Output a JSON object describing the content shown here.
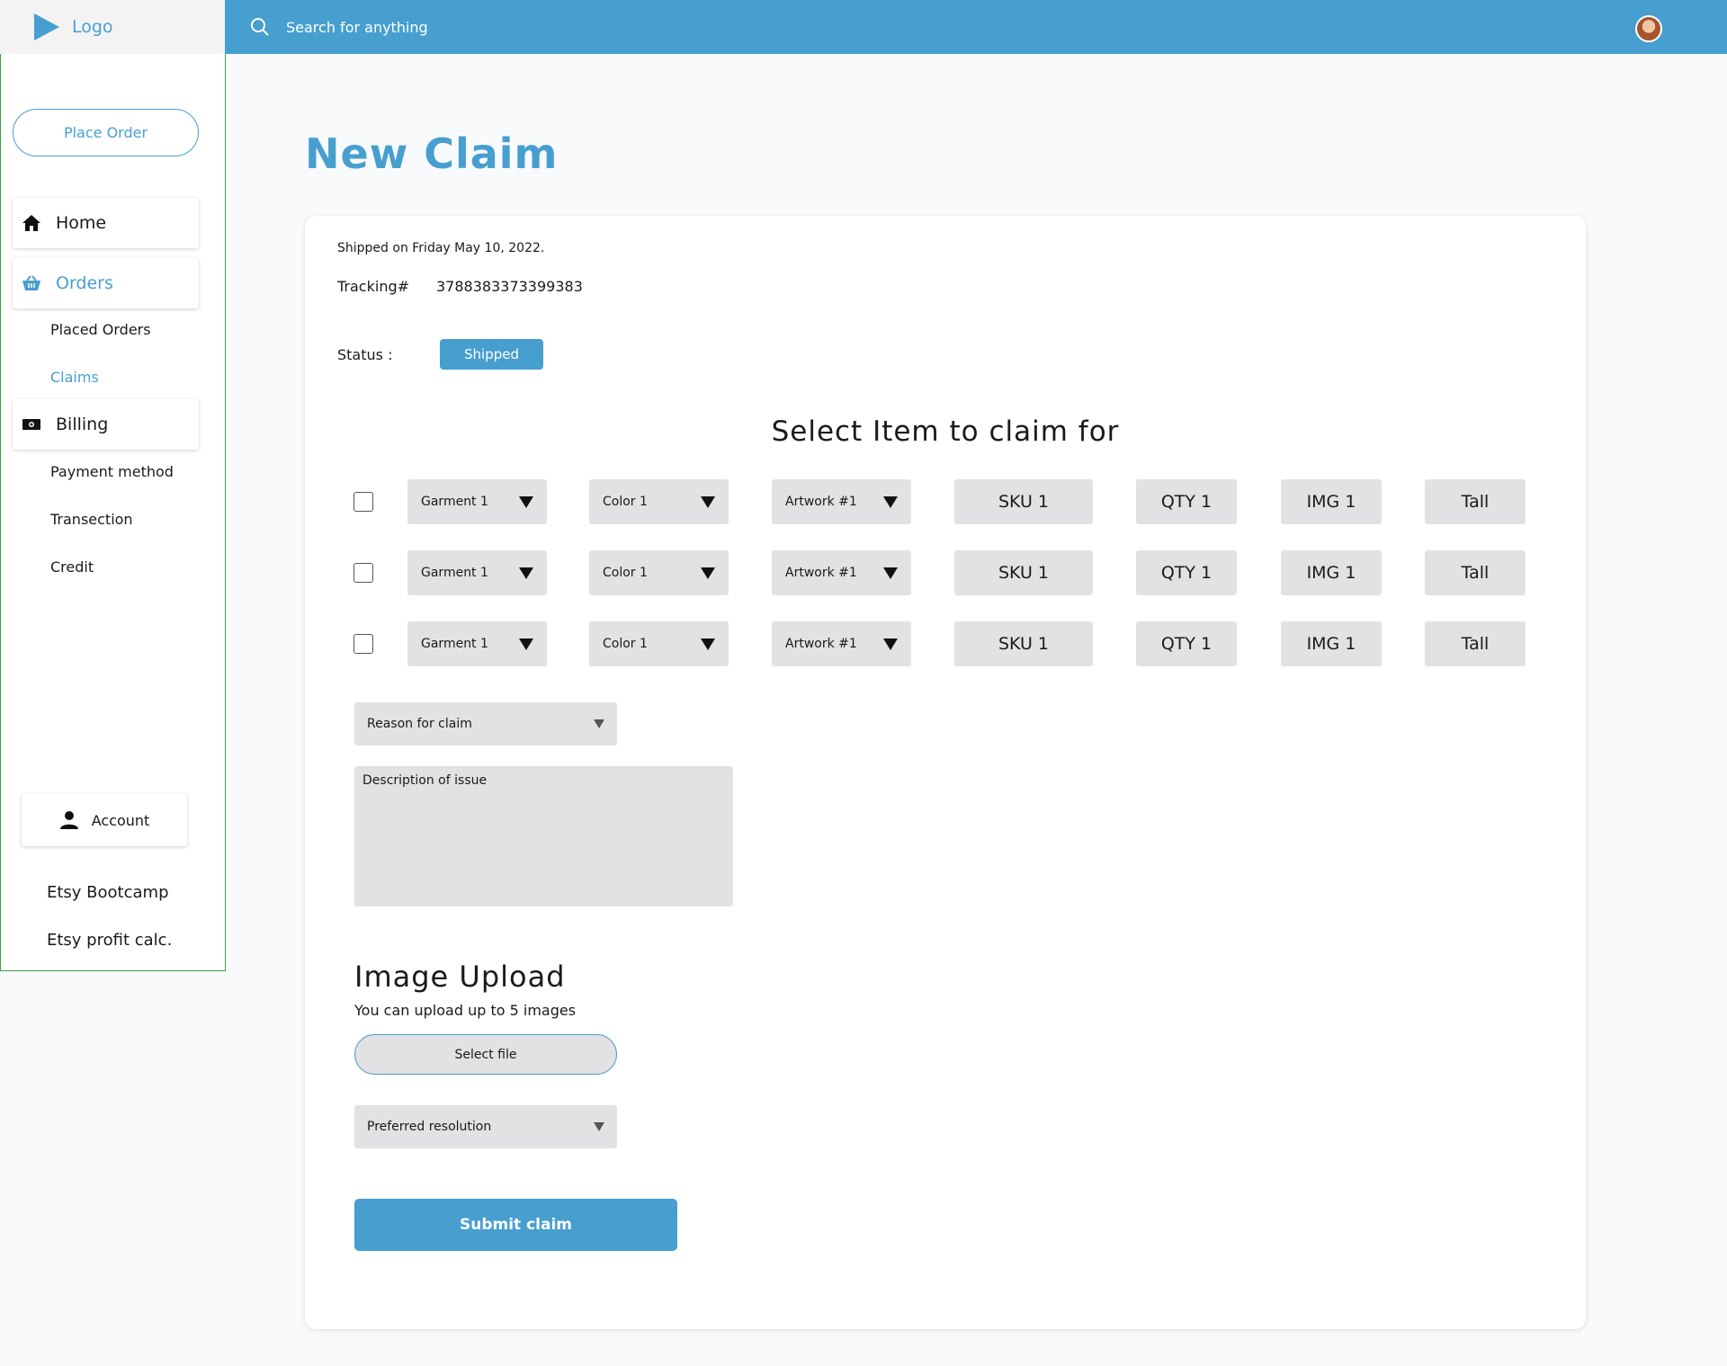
{
  "header": {
    "logo_text": "Logo",
    "search_placeholder": "Search for anything",
    "accent_color": "#479fcf"
  },
  "sidebar": {
    "place_order_label": "Place Order",
    "items": [
      {
        "label": "Home",
        "icon": "home-icon"
      },
      {
        "label": "Orders",
        "icon": "basket-icon"
      },
      {
        "label": "Placed Orders"
      },
      {
        "label": "Claims"
      },
      {
        "label": "Billing",
        "icon": "cash-icon"
      },
      {
        "label": "Payment method"
      },
      {
        "label": "Transection"
      },
      {
        "label": "Credit"
      }
    ],
    "account_label": "Account",
    "links": [
      "Etsy Bootcamp",
      "Etsy profit calc."
    ]
  },
  "main": {
    "title": "New Claim",
    "shipped_on": "Shipped on Friday May 10, 2022.",
    "tracking_label": "Tracking#",
    "tracking_number": "3788383373399383",
    "status_label": "Status :",
    "status_value": "Shipped",
    "select_title": "Select Item to claim for",
    "rows": [
      {
        "garment": "Garment 1",
        "color": "Color 1",
        "artwork": "Artwork #1",
        "sku": "SKU 1",
        "qty": "QTY 1",
        "img": "IMG 1",
        "size": "Tall"
      },
      {
        "garment": "Garment 1",
        "color": "Color 1",
        "artwork": "Artwork #1",
        "sku": "SKU 1",
        "qty": "QTY 1",
        "img": "IMG 1",
        "size": "Tall"
      },
      {
        "garment": "Garment 1",
        "color": "Color 1",
        "artwork": "Artwork #1",
        "sku": "SKU 1",
        "qty": "QTY 1",
        "img": "IMG 1",
        "size": "Tall"
      }
    ],
    "reason_placeholder": "Reason for claim",
    "description_placeholder": "Description of issue",
    "upload_title": "Image Upload",
    "upload_sub": "You can upload up to 5 images",
    "select_file_label": "Select file",
    "preferred_resolution": "Preferred resolution",
    "submit_label": "Submit claim"
  }
}
